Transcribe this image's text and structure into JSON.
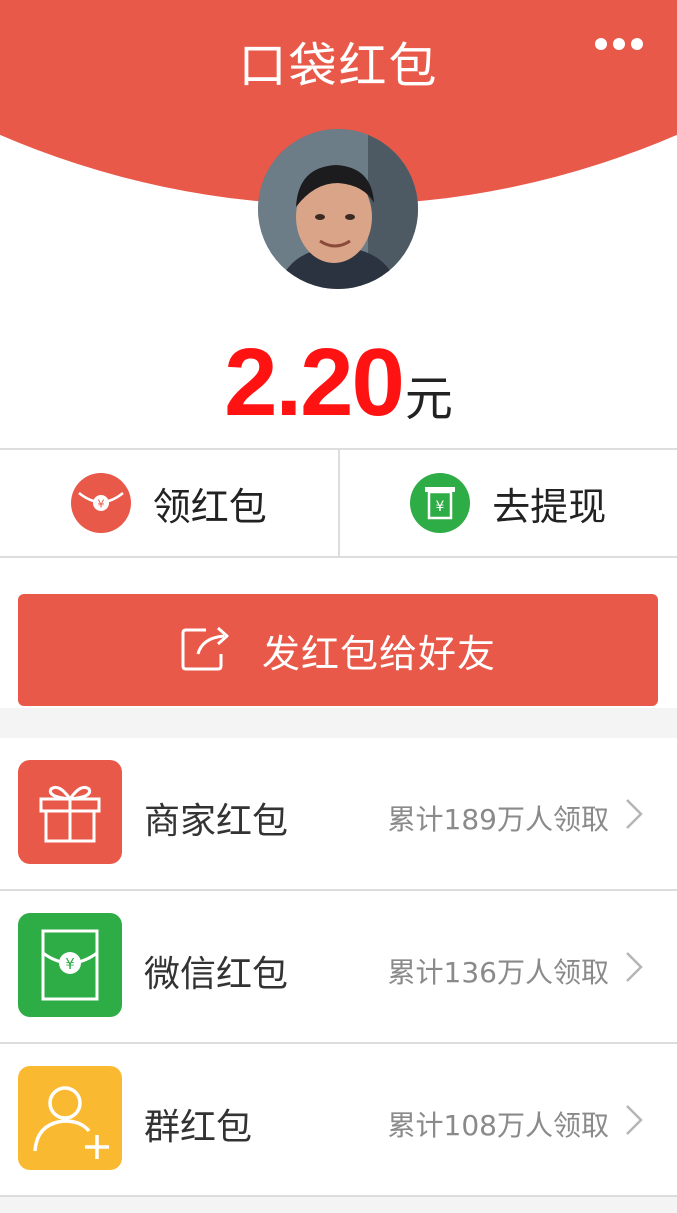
{
  "header": {
    "title": "口袋红包"
  },
  "balance": {
    "amount": "2.20",
    "unit": "元"
  },
  "actions": [
    {
      "label": "领红包",
      "icon": "red-envelope-icon"
    },
    {
      "label": "去提现",
      "icon": "withdraw-icon"
    }
  ],
  "send_button": {
    "label": "发红包给好友",
    "icon": "share-icon"
  },
  "list": [
    {
      "title": "商家红包",
      "meta": "累计189万人领取",
      "icon": "gift-icon",
      "color": "#e9594a"
    },
    {
      "title": "微信红包",
      "meta": "累计136万人领取",
      "icon": "envelope-icon",
      "color": "#2eac45"
    },
    {
      "title": "群红包",
      "meta": "累计108万人领取",
      "icon": "add-user-icon",
      "color": "#f9b931"
    }
  ],
  "colors": {
    "brand_red": "#e9594a",
    "amount_red": "#ff1212",
    "green": "#2eac45",
    "yellow": "#f9b931"
  }
}
